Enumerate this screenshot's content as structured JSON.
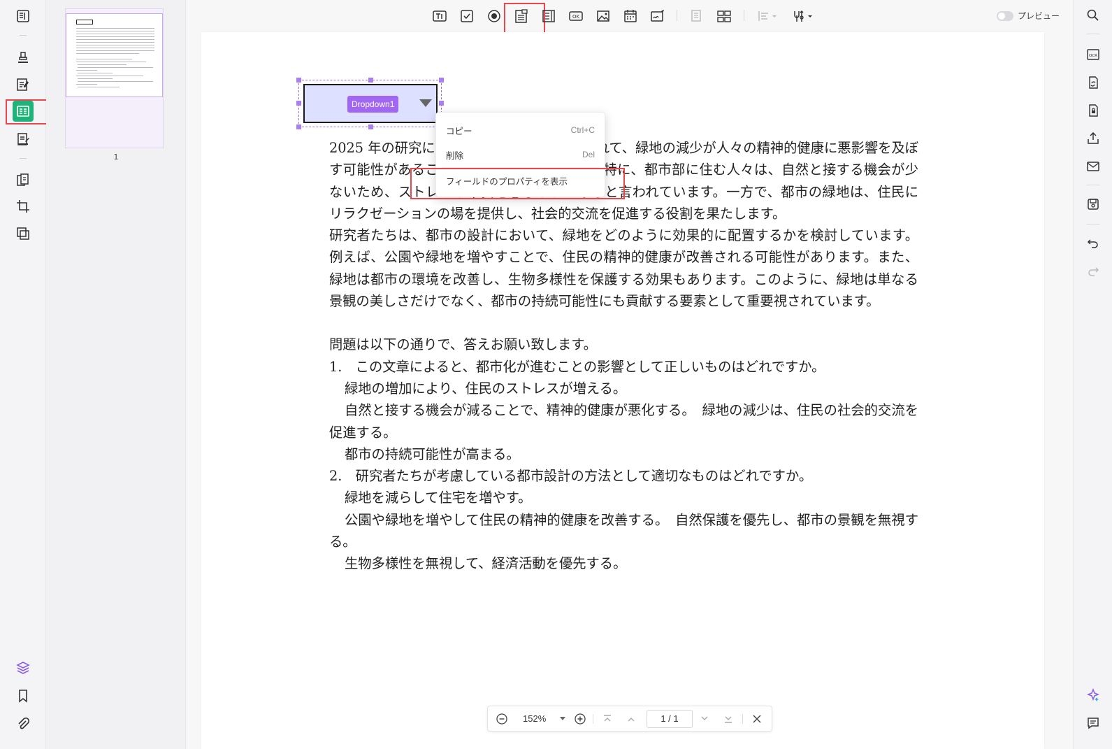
{
  "toolbar": {
    "tools": [
      "text-field-tool",
      "checkbox-tool",
      "radio-button-tool",
      "dropdown-tool",
      "list-box-tool",
      "button-tool",
      "image-field-tool",
      "date-field-tool",
      "signature-field-tool",
      "duplicate-tool",
      "grid-tool",
      "align-tool",
      "form-settings-tool"
    ],
    "preview_label": "プレビュー"
  },
  "thumbnail": {
    "page_number": "1"
  },
  "field": {
    "name": "Dropdown1"
  },
  "context_menu": {
    "items": [
      {
        "label": "コピー",
        "shortcut": "Ctrl+C"
      },
      {
        "label": "削除",
        "shortcut": "Del"
      },
      {
        "label": "フィールドのプロパティを表示",
        "shortcut": ""
      }
    ]
  },
  "document": {
    "p1": "2025 年の研究によると、都市化が進むにつれて、緑地の減少が人々の精神的健康に悪影響を及ぼす可能性があることが明らかになりました。特に、都市部に住む人々は、自然と接する機会が少ないため、ストレスや不安を感じやすくなると言われています。一方で、都市の緑地は、住民にリラクゼーションの場を提供し、社会的交流を促進する役割を果たします。",
    "p2": "研究者たちは、都市の設計において、緑地をどのように効果的に配置するかを検討しています。例えば、公園や緑地を増やすことで、住民の精神的健康が改善される可能性があります。また、緑地は都市の環境を改善し、生物多様性を保護する効果もあります。このように、緑地は単なる景観の美しさだけでなく、都市の持続可能性にも貢献する要素として重要視されています。",
    "intro": "問題は以下の通りで、答えお願い致します。",
    "q1": "1.　この文章によると、都市化が進むことの影響として正しいものはどれですか。",
    "q1a": "緑地の増加により、住民のストレスが増える。",
    "q1b": "自然と接する機会が減ることで、精神的健康が悪化する。　緑地の減少は、住民の社会的交流を促進する。",
    "q1c": "都市の持続可能性が高まる。",
    "q2": "2.　研究者たちが考慮している都市設計の方法として適切なものはどれですか。",
    "q2a": "緑地を減らして住宅を増やす。",
    "q2b": "公園や緑地を増やして住民の精神的健康を改善する。　自然保護を優先し、都市の景観を無視する。",
    "q2c": "生物多様性を無視して、経済活動を優先する。"
  },
  "bottom_bar": {
    "zoom": "152%",
    "page": "1 / 1"
  },
  "colors": {
    "accent_purple": "#a166f2",
    "rail_active": "#1fb37a",
    "highlight_red": "#e8484b",
    "field_fill": "#dde0ff"
  }
}
